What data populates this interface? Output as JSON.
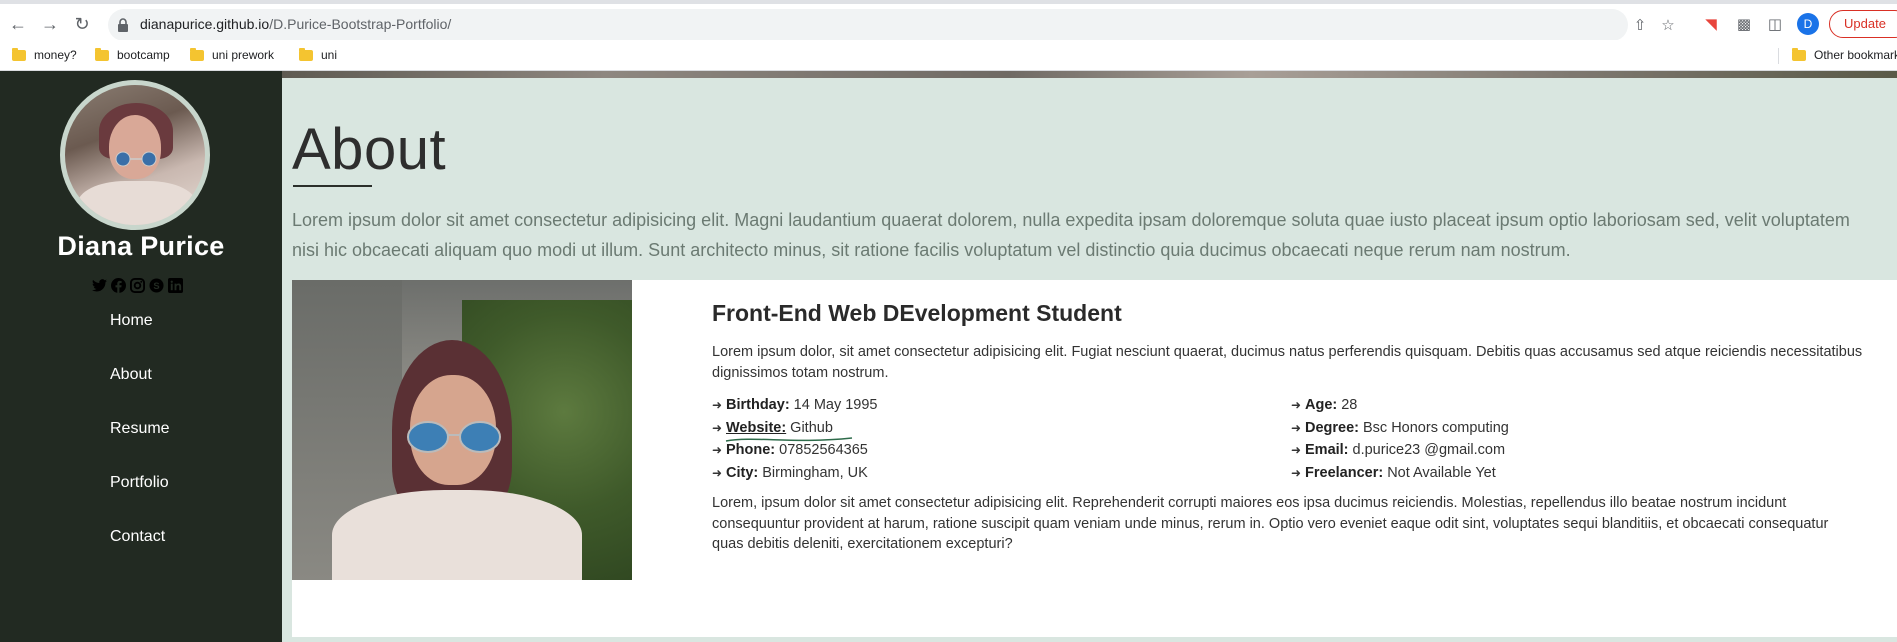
{
  "browser": {
    "url_host": "dianapurice.github.io",
    "url_path": "/D.Purice-Bootstrap-Portfolio/",
    "profile_initial": "D",
    "update_label": "Update",
    "bookmarks": [
      "money?",
      "bootcamp",
      "uni prework",
      "uni"
    ],
    "other_bookmarks": "Other bookmarks"
  },
  "sidebar": {
    "name": "Diana Purice",
    "social_icons": [
      "twitter-icon",
      "facebook-icon",
      "instagram-icon",
      "skype-icon",
      "linkedin-icon"
    ],
    "nav": [
      "Home",
      "About",
      "Resume",
      "Portfolio",
      "Contact"
    ]
  },
  "about": {
    "title": "About",
    "intro": "Lorem ipsum dolor sit amet consectetur adipisicing elit. Magni laudantium quaerat dolorem, nulla expedita ipsam doloremque soluta quae iusto placeat ipsum optio laboriosam sed, velit voluptatem nisi hic obcaecati aliquam quo modi ut illum. Sunt architecto minus, sit ratione facilis voluptatum vel distinctio quia ducimus obcaecati neque rerum nam nostrum.",
    "card_title": "Front-End Web DEvelopment Student",
    "card_desc": "Lorem ipsum dolor, sit amet consectetur adipisicing elit. Fugiat nesciunt quaerat, ducimus natus perferendis quisquam. Debitis quas accusamus sed atque reiciendis necessitatibus dignissimos totam nostrum.",
    "left_info": [
      {
        "label": "Birthday:",
        "value": "14 May 1995"
      },
      {
        "label": "Website:",
        "value": "Github"
      },
      {
        "label": "Phone:",
        "value": "07852564365"
      },
      {
        "label": "City:",
        "value": "Birmingham, UK"
      }
    ],
    "right_info": [
      {
        "label": "Age:",
        "value": "28"
      },
      {
        "label": "Degree:",
        "value": "Bsc Honors computing"
      },
      {
        "label": "Email:",
        "value": "d.purice23 @gmail.com"
      },
      {
        "label": "Freelancer:",
        "value": "Not Available Yet"
      }
    ],
    "card_foot": "Lorem, ipsum dolor sit amet consectetur adipisicing elit. Reprehenderit corrupti maiores eos ipsa ducimus reiciendis. Molestias, repellendus illo beatae nostrum incidunt consequuntur provident at harum, ratione suscipit quam veniam unde minus, rerum in. Optio vero eveniet eaque odit sint, voluptates sequi blanditiis, et obcaecati consequatur quas debitis deleniti, exercitationem excepturi?"
  },
  "colors": {
    "sidebar_bg": "#222a22",
    "main_bg": "#d9e6e0",
    "update_red": "#d93025"
  }
}
